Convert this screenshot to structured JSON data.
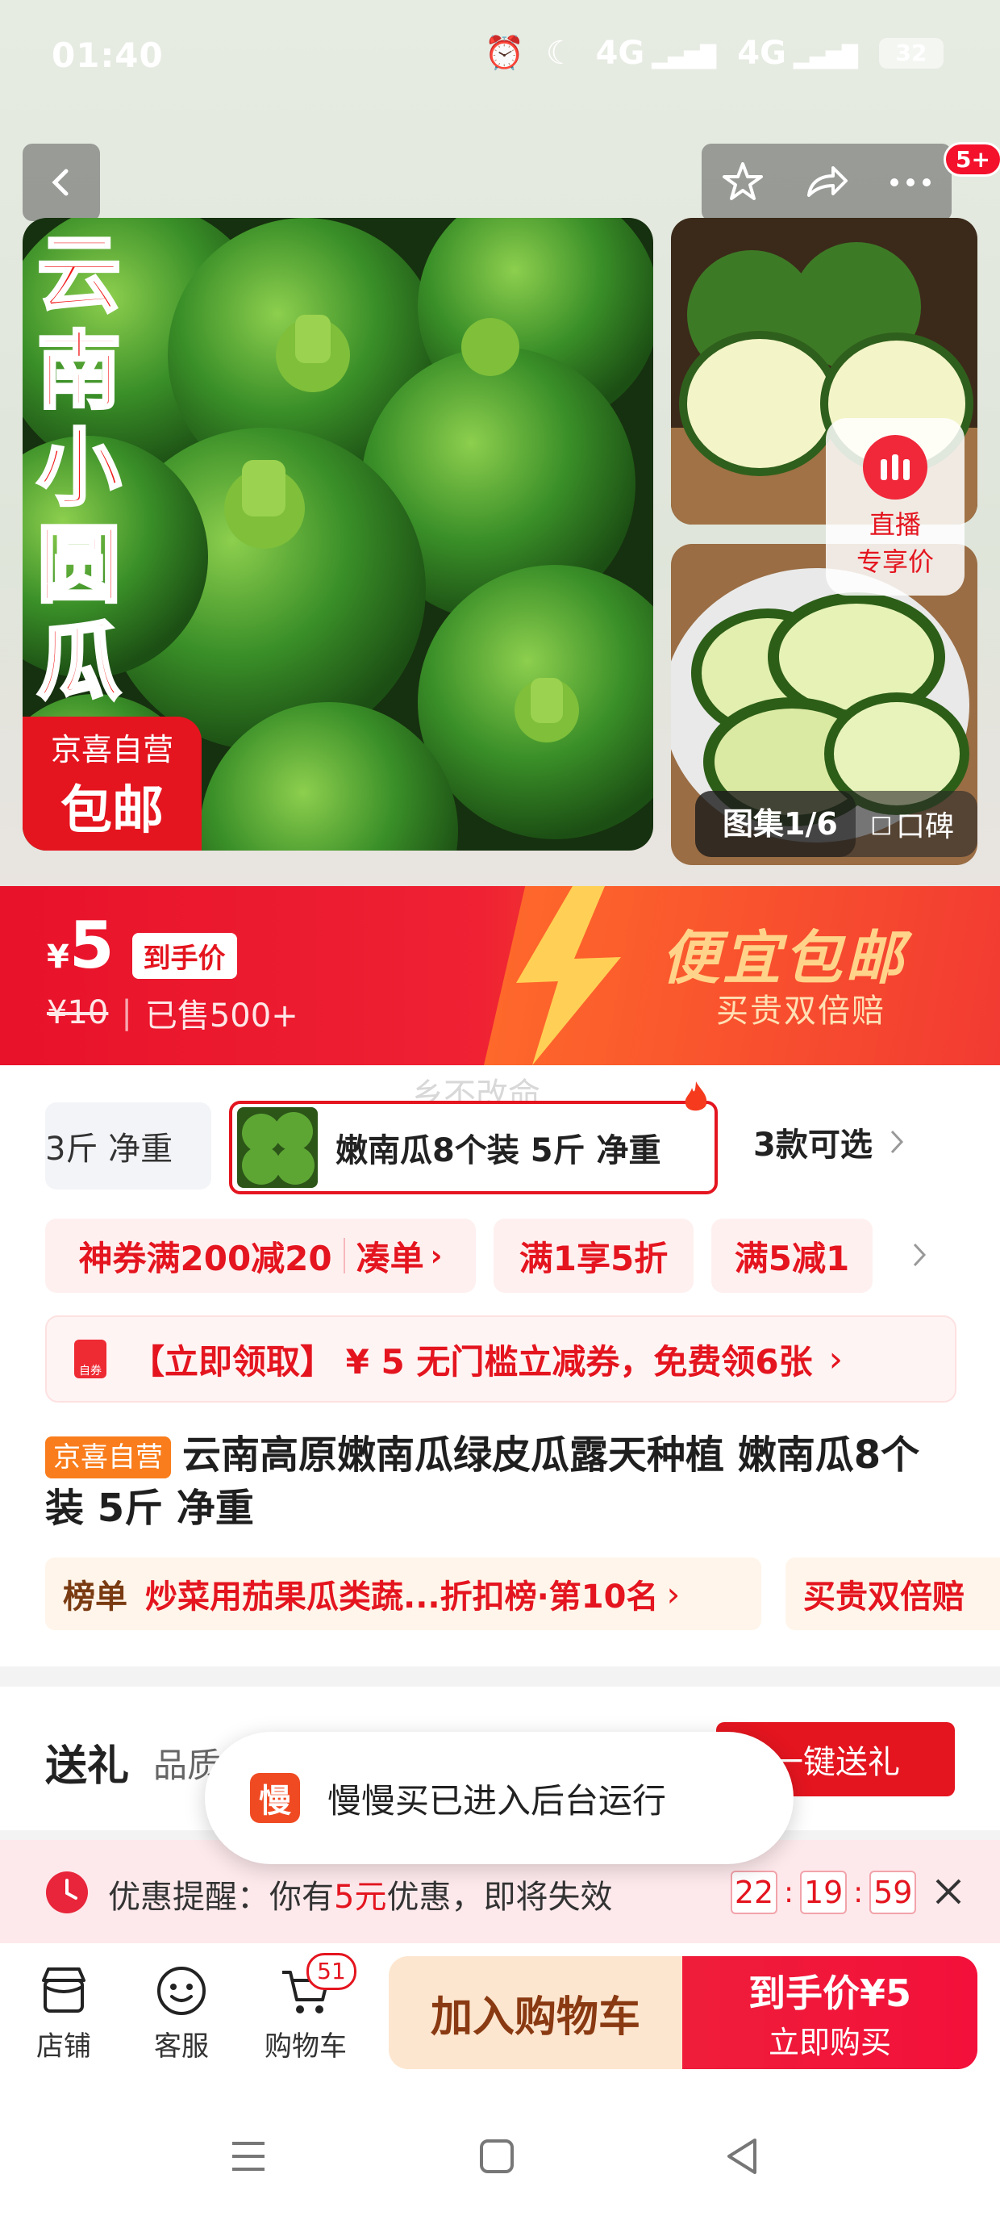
{
  "status_bar": {
    "time": "01:40",
    "battery": "32",
    "network_1": "4G",
    "network_2": "4G"
  },
  "top_nav": {
    "more_badge": "5+"
  },
  "hero": {
    "main_title_chars": [
      "云",
      "南",
      "小",
      "圆",
      "瓜"
    ],
    "jd_tag_line1": "京喜自营",
    "jd_tag_line2": "包邮",
    "live_label_1": "直播",
    "live_label_2": "专享价",
    "gallery_label": "图集1/6",
    "reviews_label": "口碑"
  },
  "price_bar": {
    "currency": "¥",
    "price": "5",
    "price_tag": "到手价",
    "original_price": "¥10",
    "sold": "已售500+",
    "slogan": "便宜包邮",
    "slogan_sub": "买贵双倍赔"
  },
  "watermark": "乡不改命",
  "variants": {
    "items": [
      {
        "label": "3斤 净重"
      },
      {
        "label": "嫩南瓜8个装 5斤 净重"
      }
    ],
    "more_label": "3款可选"
  },
  "coupons": {
    "items": [
      {
        "label": "神券满200减20"
      },
      {
        "label": "凑单"
      },
      {
        "label": "满1享5折"
      },
      {
        "label": "满5减1"
      }
    ],
    "claim_icon_text": "自券",
    "claim_text": "【立即领取】 ¥ 5 无门槛立减券，免费领6张"
  },
  "product": {
    "store_tag": "京喜自营",
    "title": "云南高原嫩南瓜绿皮瓜露天种植 嫩南瓜8个装 5斤 净重",
    "rank_label": "榜单",
    "rank_text": "炒菜用茄果瓜类蔬...折扣榜·第10名",
    "guarantee": "买贵双倍赔"
  },
  "gift": {
    "title": "送礼",
    "subtitle": "品质",
    "button": "一键送礼"
  },
  "toast": {
    "icon_text": "慢",
    "text": "慢慢买已进入后台运行"
  },
  "reminder": {
    "prefix": "优惠提醒：你有",
    "amount": "5元",
    "suffix": "优惠，即将失效",
    "countdown": [
      "22",
      "19",
      "59"
    ]
  },
  "bottom_bar": {
    "store": "店铺",
    "service": "客服",
    "cart": "购物车",
    "cart_badge": "51",
    "add_to_cart": "加入购物车",
    "buy_price_label": "到手价¥5",
    "buy_now": "立即购买"
  },
  "colors": {
    "accent": "#e8122a",
    "orange": "#f6462c",
    "gold": "#ffd38a"
  }
}
